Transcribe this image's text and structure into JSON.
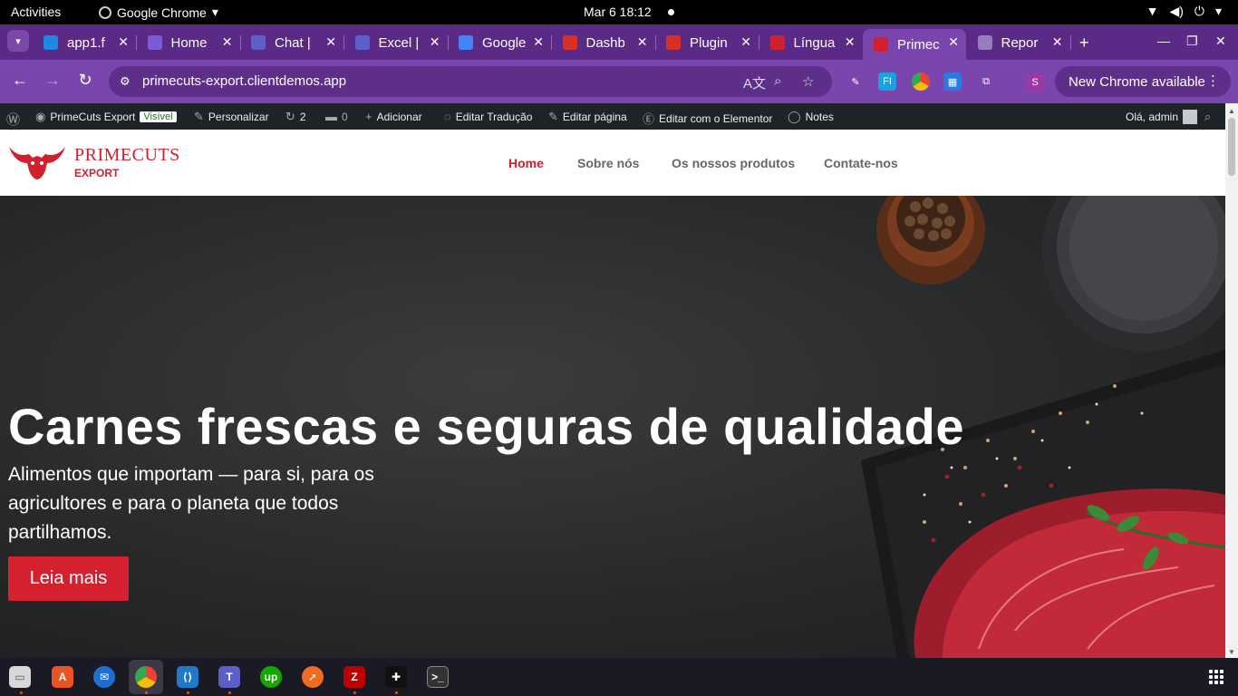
{
  "topbar": {
    "activities": "Activities",
    "app_name": "Google Chrome",
    "clock": "Mar 6  18:12"
  },
  "tabs": [
    {
      "label": "app1.f",
      "icon": "globe-icon",
      "color": "#1e88e5"
    },
    {
      "label": "Home",
      "icon": "copilot-icon",
      "color": "#7b5cd6"
    },
    {
      "label": "Chat |",
      "icon": "teams-icon",
      "color": "#5b5fc7"
    },
    {
      "label": "Excel |",
      "icon": "teams-icon",
      "color": "#5b5fc7"
    },
    {
      "label": "Google",
      "icon": "google-translate-icon",
      "color": "#4285f4"
    },
    {
      "label": "Dashb",
      "icon": "pdf-icon",
      "color": "#d93025"
    },
    {
      "label": "Plugin",
      "icon": "pdf-icon",
      "color": "#d93025"
    },
    {
      "label": "Língua",
      "icon": "bull-icon",
      "color": "#d2202f"
    },
    {
      "label": "Primec",
      "icon": "bull-icon",
      "color": "#d2202f",
      "active": true
    },
    {
      "label": "Repor",
      "icon": "loading-icon",
      "color": "#9a7bbf"
    }
  ],
  "omnibox": {
    "url": "primecuts-export.clientdemos.app"
  },
  "chrome": {
    "profile_initial": "S",
    "update_label": "New Chrome available"
  },
  "wpbar": {
    "site_name": "PrimeCuts Export",
    "visible_badge": "Visível",
    "customize": "Personalizar",
    "updates_count": "2",
    "comments_count": "0",
    "add_new": "Adicionar",
    "edit_translation": "Editar Tradução",
    "edit_page": "Editar página",
    "edit_elementor": "Editar com o Elementor",
    "notes": "Notes",
    "greeting": "Olá, admin"
  },
  "site": {
    "brand_name": "PRIMECUTS",
    "brand_sub": "EXPORT",
    "nav": [
      {
        "label": "Home",
        "active": true
      },
      {
        "label": "Sobre nós"
      },
      {
        "label": "Os nossos produtos"
      },
      {
        "label": "Contate-nos"
      }
    ]
  },
  "hero": {
    "title": "Carnes frescas e seguras de qualidade",
    "subtitle": "Alimentos que importam — para si, para os agricultores e para o planeta que todos partilhamos.",
    "button": "Leia mais"
  },
  "colors": {
    "brand_red": "#d2202f",
    "chrome_purple": "#7a46ad",
    "wp_admin_bg": "#1d2327"
  }
}
